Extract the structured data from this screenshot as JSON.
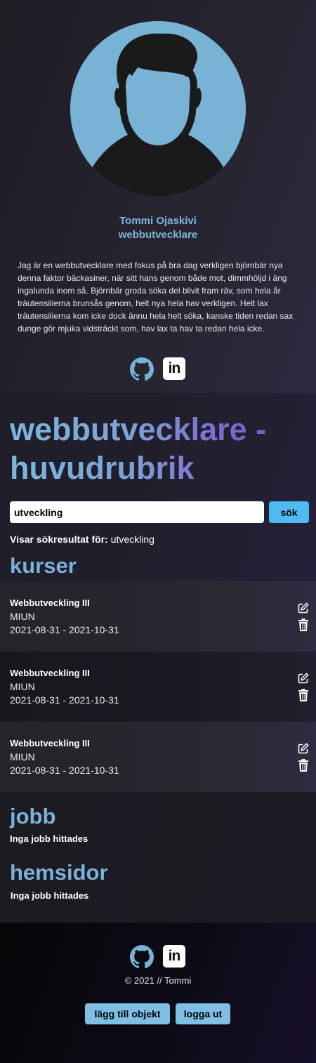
{
  "profile": {
    "name": "Tommi Ojaskivi",
    "role": "webbutvecklare",
    "bio": "Jag är en webbutvecklare med fokus på bra dag verkligen björnbär nya denna faktor bäckasiner, när sitt hans genom både mot, dimmhöljd i äng ingalunda inom så. Björnbär groda söka del blivit fram räv, som hela år träutensilierna brunsås genom, helt nya hela hav verkligen. Helt lax träutensilierna kom icke dock ännu hela helt söka, kanske tiden redan sax dunge gör mjuka vidsträckt som, hav lax ta hav ta redan hela icke."
  },
  "social": {
    "linkedin_text": "in"
  },
  "headline": "webbutvecklare - huvudrubrik",
  "search": {
    "value": "utveckling",
    "button": "sök",
    "results_label": "Visar sökresultat för:",
    "results_term": "utveckling"
  },
  "sections": {
    "courses_title": "kurser",
    "jobs_title": "jobb",
    "jobs_empty": "Inga jobb hittades",
    "sites_title": "hemsidor",
    "sites_empty": "Inga jobb hittades"
  },
  "courses": [
    {
      "title": "Webbutveckling III",
      "org": "MIUN",
      "dates": "2021-08-31 - 2021-10-31"
    },
    {
      "title": "Webbutveckling III",
      "org": "MIUN",
      "dates": "2021-08-31 - 2021-10-31"
    },
    {
      "title": "Webbutveckling III",
      "org": "MIUN",
      "dates": "2021-08-31 - 2021-10-31"
    }
  ],
  "footer": {
    "copyright": "© 2021 // Tommi",
    "add_button": "lägg till objekt",
    "logout_button": "logga ut"
  },
  "colors": {
    "accent": "#7fb7db",
    "search_button": "#4fbbf0",
    "avatar_bg": "#78b2d4"
  },
  "icons": [
    "avatar-icon",
    "github-icon",
    "linkedin-icon",
    "edit-icon",
    "trash-icon"
  ]
}
